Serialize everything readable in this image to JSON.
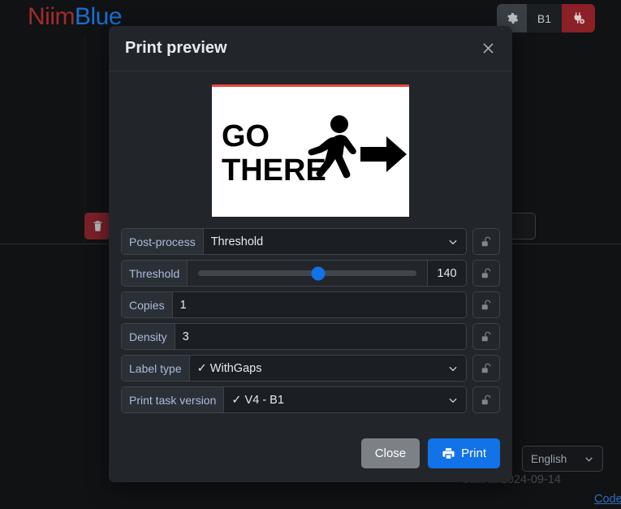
{
  "app": {
    "brand_first": "Niim",
    "brand_second": "Blue"
  },
  "topbar": {
    "settings_icon": "gear-icon",
    "device_label": "B1",
    "disconnect_icon": "plug-disconnect-icon"
  },
  "background": {
    "delete_icon": "trash-icon",
    "language": "English",
    "language_chevron": "chevron-down-icon",
    "built_text": "built at 2024-09-14",
    "code_link": "Code"
  },
  "modal": {
    "title": "Print preview",
    "close_icon": "close-icon",
    "preview": {
      "line1": "GO",
      "line2": "THERE",
      "pictogram": "walking-person-icon",
      "arrow": "arrow-right-icon"
    },
    "rows": [
      {
        "name": "post-process",
        "label": "Post-process",
        "value": "Threshold",
        "kind": "select",
        "lock_icon": "unlock-icon"
      },
      {
        "name": "threshold",
        "label": "Threshold",
        "value": "140",
        "kind": "slider",
        "slider_percent": 55,
        "lock_icon": "unlock-icon"
      },
      {
        "name": "copies",
        "label": "Copies",
        "value": "1",
        "kind": "input",
        "lock_icon": "unlock-icon"
      },
      {
        "name": "density",
        "label": "Density",
        "value": "3",
        "kind": "input",
        "lock_icon": "unlock-icon"
      },
      {
        "name": "label-type",
        "label": "Label type",
        "value": "✓ WithGaps",
        "kind": "select",
        "lock_icon": "unlock-icon"
      },
      {
        "name": "print-task-version",
        "label": "Print task version",
        "value": "✓ V4 - B1",
        "kind": "select",
        "lock_icon": "unlock-icon"
      }
    ],
    "buttons": {
      "close": "Close",
      "print": "Print",
      "print_icon": "printer-icon"
    }
  },
  "colors": {
    "accent_blue": "#1272e8",
    "brand_red": "#a02c2c",
    "brand_blue": "#1a6fd4",
    "danger_red": "#8b2026",
    "label_red_line": "#e8483f"
  }
}
